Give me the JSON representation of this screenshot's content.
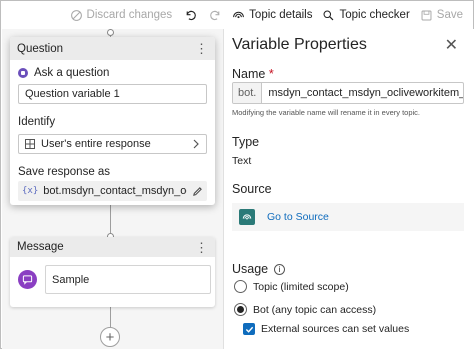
{
  "toolbar": {
    "discard_label": "Discard changes",
    "topic_details_label": "Topic details",
    "topic_checker_label": "Topic checker",
    "save_label": "Save"
  },
  "question_node": {
    "title": "Question",
    "ask_label": "Ask a question",
    "question_value": "Question variable 1",
    "identify_label": "Identify",
    "identify_value": "User's entire response",
    "save_response_label": "Save response as",
    "save_variable": "bot.msdyn_contact_msdyn_oclivew..."
  },
  "message_node": {
    "title": "Message",
    "text": "Sample"
  },
  "panel": {
    "title": "Variable Properties",
    "name_label": "Name",
    "required_mark": "*",
    "name_prefix": "bot.",
    "name_value": "msdyn_contact_msdyn_ocliveworkitem_Custo...",
    "name_hint": "Modifying the variable name will rename it in every topic.",
    "type_label": "Type",
    "type_value": "Text",
    "source_label": "Source",
    "go_to_source_label": "Go to Source",
    "usage_label": "Usage",
    "usage_options": [
      {
        "label": "Topic (limited scope)",
        "selected": false
      },
      {
        "label": "Bot (any topic can access)",
        "selected": true
      }
    ],
    "external_sources_label": "External sources can set values",
    "external_sources_checked": true
  },
  "colors": {
    "accent": "#0f6cbd",
    "ask_icon": "#6b4fbb",
    "message_icon": "#8a3ec2",
    "source_icon": "#2b7a78",
    "required": "#c50f1f"
  }
}
